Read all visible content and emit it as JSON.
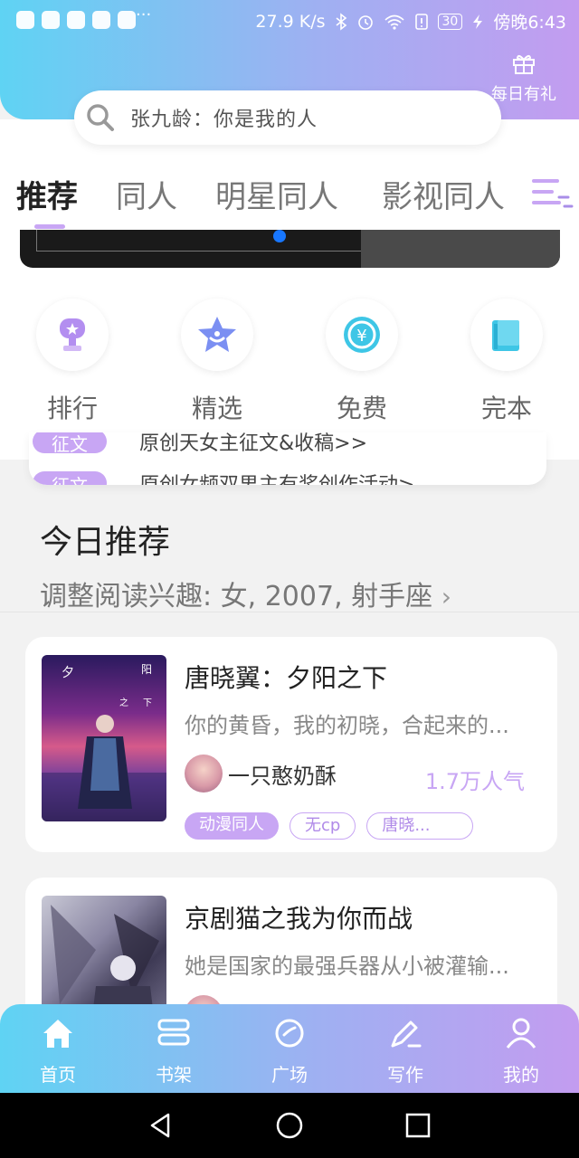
{
  "status_bar": {
    "speed": "27.9 K/s",
    "battery": "30",
    "time": "傍晚6:43",
    "dots": "···"
  },
  "header": {
    "gift_label": "每日有礼",
    "search_placeholder": "张九龄：你是我的人"
  },
  "tabs": [
    {
      "label": "推荐",
      "active": true
    },
    {
      "label": "同人"
    },
    {
      "label": "明星同人"
    },
    {
      "label": "影视同人"
    }
  ],
  "quick_links": [
    {
      "label": "排行",
      "icon": "trophy-icon"
    },
    {
      "label": "精选",
      "icon": "star-icon"
    },
    {
      "label": "免费",
      "icon": "yuan-icon"
    },
    {
      "label": "完本",
      "icon": "book-icon"
    }
  ],
  "notices": [
    {
      "tag": "征文",
      "text": "原创天女主征文&收稿>>"
    },
    {
      "tag": "征文",
      "text": "原创女频双男主有奖创作活动>"
    }
  ],
  "recommend": {
    "title": "今日推荐",
    "subtitle": "调整阅读兴趣: 女, 2007, 射手座",
    "books": [
      {
        "title": "唐晓翼：夕阳之下",
        "desc": "你的黄昏，我的初晓，合起来的...",
        "author": "一只憨奶酥",
        "popularity": "1.7万人气",
        "tags": [
          "动漫同人",
          "无cp",
          "唐晓..."
        ]
      },
      {
        "title": "京剧猫之我为你而战",
        "desc": "她是国家的最强兵器从小被灌输..."
      }
    ]
  },
  "bottom_nav": [
    {
      "label": "首页",
      "icon": "home-icon"
    },
    {
      "label": "书架",
      "icon": "bookshelf-icon"
    },
    {
      "label": "广场",
      "icon": "planet-icon"
    },
    {
      "label": "写作",
      "icon": "pen-icon"
    },
    {
      "label": "我的",
      "icon": "user-icon"
    }
  ],
  "colors": {
    "accent": "#c8a6f4",
    "gradient_start": "#5fd3f3",
    "gradient_end": "#c39cf0"
  }
}
